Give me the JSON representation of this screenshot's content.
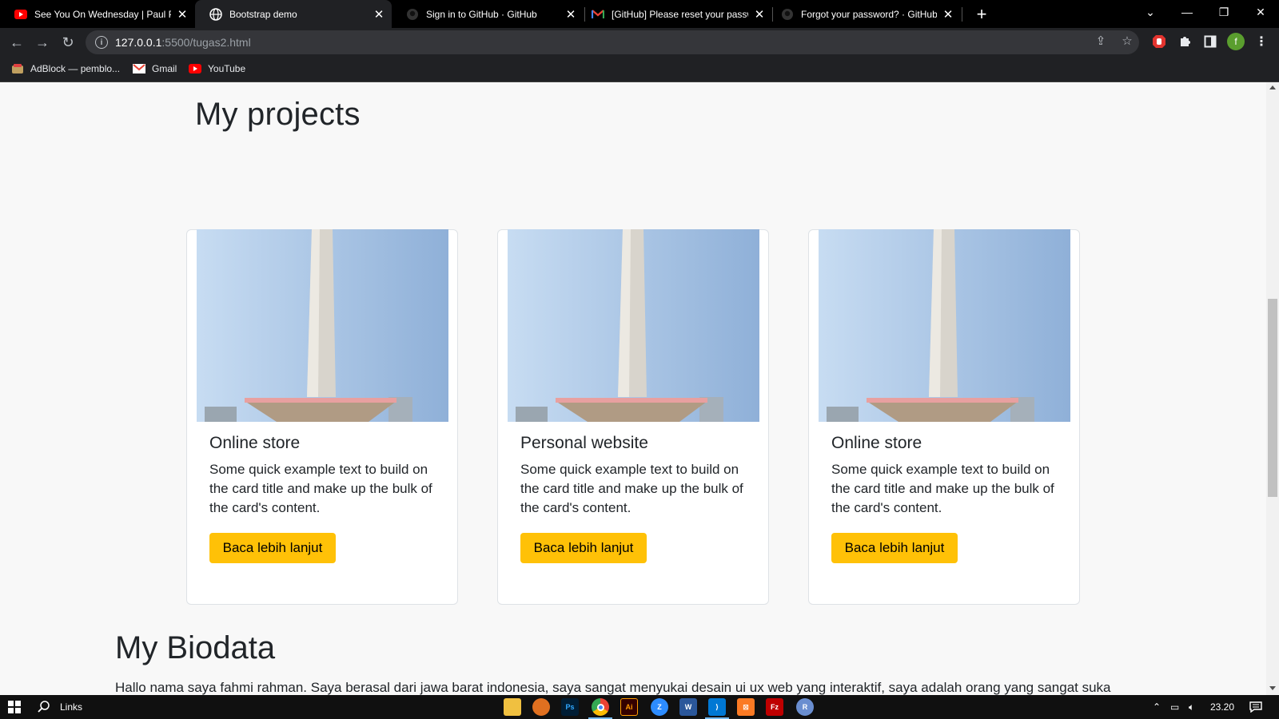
{
  "browser": {
    "tabs": [
      {
        "title": "See You On Wednesday | Paul Pa",
        "icon": "youtube-icon",
        "active": false
      },
      {
        "title": "Bootstrap demo",
        "icon": "globe-icon",
        "active": true
      },
      {
        "title": "Sign in to GitHub · GitHub",
        "icon": "github-icon",
        "active": false
      },
      {
        "title": "[GitHub] Please reset your passw",
        "icon": "gmail-icon",
        "active": false
      },
      {
        "title": "Forgot your password? · GitHub",
        "icon": "github-icon",
        "active": false
      }
    ],
    "url_host": "127.0.0.1",
    "url_path": ":5500/tugas2.html",
    "profile_initial": "f",
    "bookmarks": [
      {
        "label": "AdBlock — pemblo...",
        "icon": "adblock-icon"
      },
      {
        "label": "Gmail",
        "icon": "gmail-icon"
      },
      {
        "label": "YouTube",
        "icon": "youtube-icon"
      }
    ]
  },
  "page": {
    "projects_heading": "My projects",
    "cards": [
      {
        "title": "Online store",
        "text": "Some quick example text to build on the card title and make up the bulk of the card's content.",
        "button": "Baca lebih lanjut"
      },
      {
        "title": "Personal website",
        "text": "Some quick example text to build on the card title and make up the bulk of the card's content.",
        "button": "Baca lebih lanjut"
      },
      {
        "title": "Online store",
        "text": "Some quick example text to build on the card title and make up the bulk of the card's content.",
        "button": "Baca lebih lanjut"
      }
    ],
    "biodata_heading": "My Biodata",
    "biodata_text": "Hallo nama saya fahmi rahman. Saya berasal dari jawa barat indonesia, saya sangat menyukai desain ui ux web yang interaktif, saya adalah orang yang sangat suka"
  },
  "taskbar": {
    "links_label": "Links",
    "clock": "23.20",
    "apps": [
      "file-explorer-icon",
      "fl-studio-icon",
      "photoshop-icon",
      "chrome-icon",
      "illustrator-icon",
      "zoom-icon",
      "word-icon",
      "vscode-icon",
      "xampp-icon",
      "filezilla-icon",
      "r-icon"
    ]
  },
  "colors": {
    "button_accent": "#ffc107",
    "chrome_dark": "#202124",
    "page_bg": "#f8f8f8"
  }
}
